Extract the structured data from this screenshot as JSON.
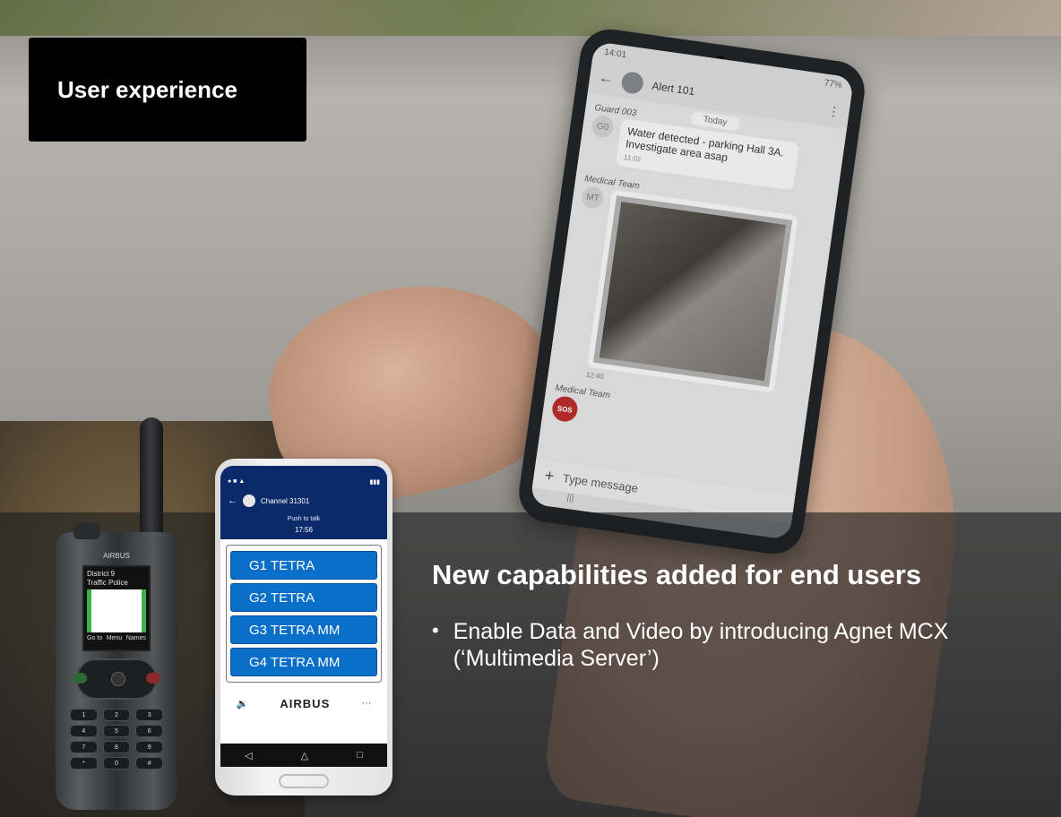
{
  "slide": {
    "title": "User experience",
    "headline": "New capabilities added for end users",
    "bullets": [
      "Enable Data and Video by introducing Agnet MCX (‘Multimedia Server’)"
    ]
  },
  "main_phone": {
    "status_time": "14:01",
    "status_battery": "77%",
    "chat_name": "Alert 101",
    "day_label": "Today",
    "messages": [
      {
        "sender": "Guard 003",
        "initials": "G0",
        "text": "Water detected - parking Hall 3A. Investigate area asap",
        "time": "11:02"
      },
      {
        "sender": "Medical Team",
        "initials": "MT",
        "time": "12:40"
      },
      {
        "sender": "Medical Team"
      }
    ],
    "sos_label": "SOS",
    "compose_placeholder": "Type message",
    "compose_plus": "+"
  },
  "tetra_radio": {
    "brand": "AIRBUS",
    "screen_line1": "District 9",
    "screen_line2": "Traffic Police",
    "softkey_left": "Go to",
    "softkey_mid": "Menu",
    "softkey_right": "Names",
    "keys": [
      "1",
      "2",
      "3",
      "4",
      "5",
      "6",
      "7",
      "8",
      "9",
      "*",
      "0",
      "#"
    ]
  },
  "android_phone": {
    "channel": "Channel 31301",
    "ptt_label": "Push to talk",
    "clock": "17:56",
    "groups": [
      "G1 TETRA",
      "G2 TETRA",
      "G3 TETRA MM",
      "G4 TETRA MM"
    ],
    "footer_logo": "AIRBUS",
    "footer_more": "···",
    "footer_speaker": "🔉",
    "nav_back": "◁",
    "nav_home": "△",
    "nav_recent": "□"
  },
  "colors": {
    "group_button": "#0a6fc9",
    "android_header": "#0b2a6b",
    "title_box": "#000000",
    "sos": "#b02a2a"
  },
  "icons": {
    "back": "arrow-left-icon",
    "speaker": "speaker-icon",
    "more": "more-icon"
  }
}
